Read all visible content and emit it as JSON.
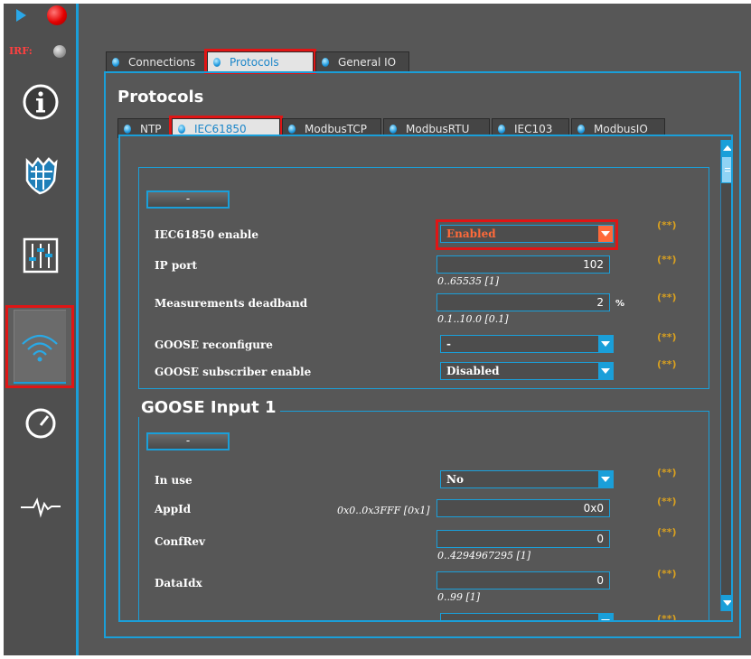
{
  "sidebar": {
    "irf_label": "IRF:",
    "buttons": [
      {
        "name": "info",
        "icon": "info-icon"
      },
      {
        "name": "security",
        "icon": "shield-icon"
      },
      {
        "name": "settings",
        "icon": "sliders-icon"
      },
      {
        "name": "communication",
        "icon": "wireless-icon",
        "selected": true
      },
      {
        "name": "monitoring",
        "icon": "gauge-icon"
      },
      {
        "name": "events",
        "icon": "waveform-icon"
      }
    ]
  },
  "main_tabs": [
    {
      "label": "Connections"
    },
    {
      "label": "Protocols",
      "active": true
    },
    {
      "label": "General IO"
    }
  ],
  "page_title": "Protocols",
  "protocol_tabs": [
    {
      "label": "NTP"
    },
    {
      "label": "IEC61850",
      "active": true
    },
    {
      "label": "ModbusTCP"
    },
    {
      "label": "ModbusRTU"
    },
    {
      "label": "IEC103"
    },
    {
      "label": "ModbusIO"
    }
  ],
  "iec61850": {
    "collapse_label": "-",
    "enable": {
      "label": "IEC61850 enable",
      "value": "Enabled",
      "note": "(**)"
    },
    "ip_port": {
      "label": "IP port",
      "value": "102",
      "range": "0..65535 [1]",
      "note": "(**)"
    },
    "deadband": {
      "label": "Measurements deadband",
      "value": "2",
      "unit": "%",
      "range": "0.1..10.0 [0.1]",
      "note": "(**)"
    },
    "goose_reconfigure": {
      "label": "GOOSE reconfigure",
      "value": "-",
      "note": "(**)"
    },
    "goose_subscriber": {
      "label": "GOOSE subscriber enable",
      "value": "Disabled",
      "note": "(**)"
    }
  },
  "goose_input": {
    "title": "GOOSE Input 1",
    "collapse_label": "-",
    "in_use": {
      "label": "In use",
      "value": "No",
      "note": "(**)"
    },
    "appid": {
      "label": "AppId",
      "range": "0x0..0x3FFF [0x1]",
      "value": "0x0",
      "note": "(**)"
    },
    "confrev": {
      "label": "ConfRev",
      "value": "0",
      "range": "0..4294967295 [1]",
      "note": "(**)"
    },
    "dataidx": {
      "label": "DataIdx",
      "value": "0",
      "range": "0..99 [1]",
      "note": "(**)"
    },
    "next_note": "(**)"
  },
  "colors": {
    "accent": "#1a9fd9",
    "highlight": "#e01515",
    "enabled": "#ff6a3a",
    "note": "#d8a020",
    "background": "#575757"
  }
}
